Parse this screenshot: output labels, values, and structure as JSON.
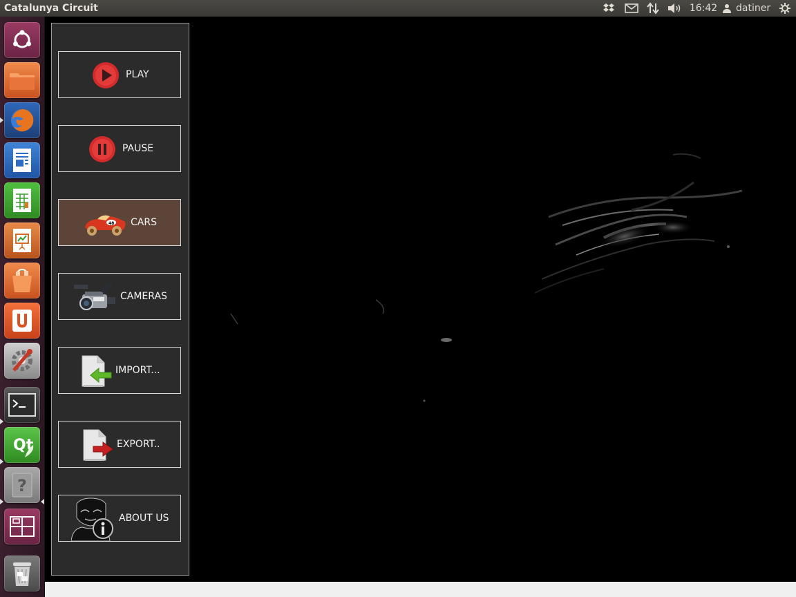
{
  "window": {
    "title": "Catalunya Circuit"
  },
  "top_panel": {
    "indicators": [
      "dropbox-icon",
      "mail-icon",
      "network-icon",
      "volume-icon"
    ],
    "clock": "16:42",
    "user": "datiner"
  },
  "launcher": {
    "items": [
      {
        "name": "ubuntu-dash",
        "icon": "ubuntu-logo-icon",
        "color": "#7a2e4e"
      },
      {
        "name": "files",
        "icon": "folder-icon",
        "color": "#e8743b"
      },
      {
        "name": "firefox",
        "icon": "firefox-icon",
        "color": "#2a5da8",
        "running": true
      },
      {
        "name": "writer",
        "icon": "writer-icon",
        "color": "#2c6cc4"
      },
      {
        "name": "calc",
        "icon": "calc-icon",
        "color": "#3a9c2e"
      },
      {
        "name": "impress",
        "icon": "impress-icon",
        "color": "#d46d2a"
      },
      {
        "name": "software-center",
        "icon": "shopping-bag-icon",
        "color": "#d85a1c"
      },
      {
        "name": "ubuntu-one",
        "icon": "ubuntu-one-icon",
        "color": "#e0511f"
      },
      {
        "name": "system-settings",
        "icon": "settings-icon",
        "color": "#c43828"
      },
      {
        "name": "terminal",
        "icon": "terminal-icon",
        "color": "#3a3a3a",
        "running": true
      },
      {
        "name": "qt-creator",
        "icon": "qt-icon",
        "color": "#41a833",
        "running": true
      },
      {
        "name": "unknown-app",
        "icon": "question-icon",
        "color": "#8a8a8a",
        "running": true,
        "focused": true
      },
      {
        "name": "workspace-switcher",
        "icon": "workspaces-icon",
        "color": "#7a2e4e"
      },
      {
        "name": "trash",
        "icon": "trash-icon",
        "color": "#6a6a6a"
      }
    ]
  },
  "menu": {
    "buttons": [
      {
        "label": "PLAY",
        "icon": "play-icon"
      },
      {
        "label": "PAUSE",
        "icon": "pause-icon"
      },
      {
        "label": "CARS",
        "icon": "race-car-icon",
        "active": true
      },
      {
        "label": "CAMERAS",
        "icon": "video-camera-icon"
      },
      {
        "label": "IMPORT...",
        "icon": "import-file-icon"
      },
      {
        "label": "EXPORT..",
        "icon": "export-file-icon"
      },
      {
        "label": "ABOUT US",
        "icon": "about-us-icon"
      }
    ]
  }
}
